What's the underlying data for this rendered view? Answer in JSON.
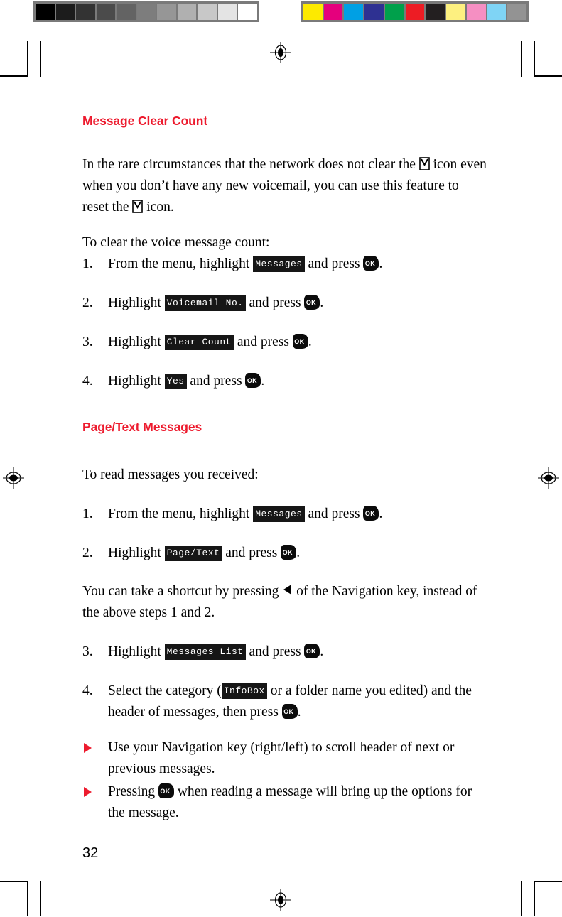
{
  "page": {
    "number": "32",
    "accent_color": "#ed1b2e",
    "lcd_bg_color": "#161616",
    "lcd_fg_color": "#ffffff"
  },
  "calibration": {
    "grayscale_swatches": [
      "#000000",
      "#1c1c1c",
      "#333333",
      "#4b4b4b",
      "#636363",
      "#7d7d7d",
      "#969696",
      "#b0b0b0",
      "#c8c8c8",
      "#e4e4e4",
      "#ffffff"
    ],
    "color_swatches": [
      "#fdea00",
      "#e5007d",
      "#00a0e4",
      "#2e3192",
      "#00a04b",
      "#ed1c24",
      "#231f20",
      "#fdf080",
      "#f58fc2",
      "#7fd4f5",
      "#939393"
    ]
  },
  "section_one": {
    "heading": "Message Clear Count",
    "intro_part_1": "In the rare circumstances that the network does not clear the",
    "intro_part_2": "icon even when you don’t have any new voicemail, you can use this feature to reset the",
    "intro_part_3": "icon.",
    "lead_in": "To clear the voice message count:",
    "steps": [
      {
        "number": "1.",
        "text_before": "From the menu, highlight",
        "lcd_label": "Messages",
        "text_middle": "and press",
        "text_after": "."
      },
      {
        "number": "2.",
        "text_before": "Highlight",
        "lcd_label": "Voicemail No.",
        "text_middle": "and press",
        "text_after": "."
      },
      {
        "number": "3.",
        "text_before": "Highlight",
        "lcd_label": "Clear Count",
        "text_middle": "and press",
        "text_after": "."
      },
      {
        "number": "4.",
        "text_before": "Highlight",
        "lcd_label": "Yes",
        "text_middle": "and press",
        "text_after": "."
      }
    ]
  },
  "section_two": {
    "heading": "Page/Text Messages",
    "lead_in": "To read messages you received:",
    "steps_first": [
      {
        "number": "1.",
        "text_before": "From the menu, highlight",
        "lcd_label": "Messages",
        "text_middle": "and press",
        "text_after": "."
      },
      {
        "number": "2.",
        "text_before": "Highlight",
        "lcd_label": "Page/Text",
        "text_middle": "and press",
        "text_after": "."
      }
    ],
    "shortcut_note_part_1": "You can take a shortcut by pressing",
    "shortcut_note_part_2": "of the Navigation key, instead of the above steps 1 and 2.",
    "steps_second": [
      {
        "number": "3.",
        "text_before": "Highlight",
        "lcd_label": "Messages List",
        "text_middle": "and press",
        "text_after": "."
      }
    ],
    "step_four": {
      "number": "4.",
      "text_before": "Select the category (",
      "lcd_label": "InfoBox",
      "text_middle": "or a folder name you edited) and the header of messages, then press",
      "text_after": "."
    },
    "bullets": [
      {
        "text_before": "Use your Navigation key (right/left) to scroll header of next or previous messages.",
        "text_middle": "",
        "text_after": ""
      },
      {
        "text_before": "Pressing",
        "text_middle": "when reading a message will bring up the options for the message.",
        "text_after": ""
      }
    ]
  },
  "icons": {
    "ok_key_label": "OK",
    "envelope_name": "envelope-icon",
    "nav_left_name": "nav-left-arrow-icon",
    "bullet_name": "triangle-bullet-icon"
  }
}
